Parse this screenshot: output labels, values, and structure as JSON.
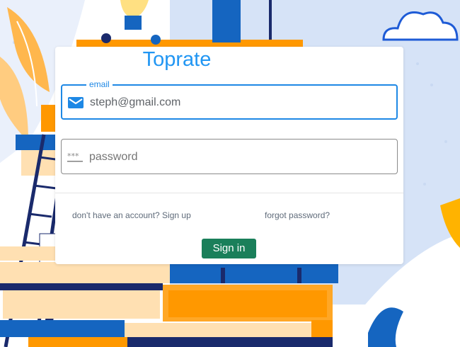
{
  "app": {
    "title": "Toprate"
  },
  "form": {
    "email": {
      "label": "email",
      "value": "steph@gmail.com",
      "icon": "mail-icon"
    },
    "password": {
      "placeholder": "password",
      "icon": "password-dots-icon"
    },
    "signup_link": "don't have an account? Sign up",
    "forgot_link": "forgot password?",
    "submit_label": "Sign in"
  },
  "colors": {
    "accent": "#2196f3",
    "button": "#1a7f5a",
    "illustration_orange": "#ff9800",
    "illustration_blue": "#1565c0",
    "illustration_navy": "#1a2a6c",
    "background_blue": "#d6e3f7"
  }
}
